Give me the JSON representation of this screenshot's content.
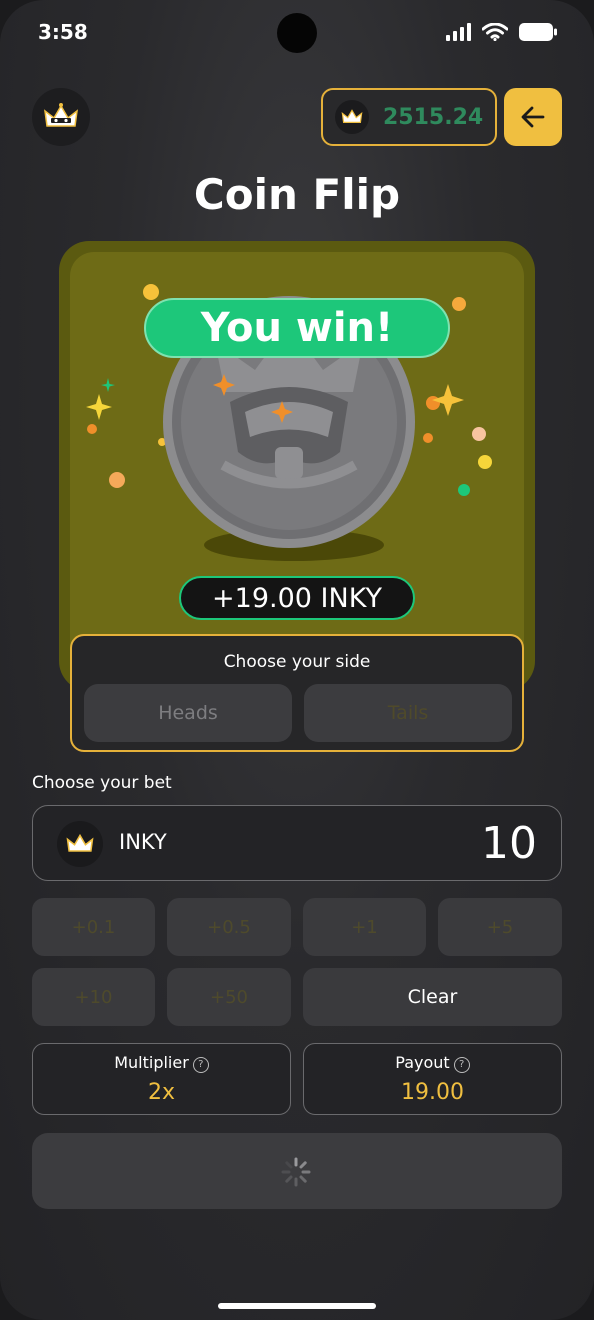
{
  "status_bar": {
    "time": "3:58"
  },
  "header": {
    "balance": "2515.24"
  },
  "game": {
    "title": "Coin Flip",
    "result_text": "You win!",
    "reward_text": "+19.00 INKY"
  },
  "side_select": {
    "label": "Choose your side",
    "options": [
      "Heads",
      "Tails"
    ]
  },
  "bet": {
    "label": "Choose your bet",
    "currency": "INKY",
    "value": "10"
  },
  "quick_amounts": [
    "+0.1",
    "+0.5",
    "+1",
    "+5",
    "+10",
    "+50"
  ],
  "clear_label": "Clear",
  "stats": {
    "multiplier_label": "Multiplier",
    "multiplier_value": "2x",
    "payout_label": "Payout",
    "payout_value": "19.00"
  },
  "colors": {
    "accent_gold": "#f0bf40",
    "win_green": "#1dc77a",
    "balance_green": "#2f8a5d",
    "card_olive": "#6e6b16"
  }
}
